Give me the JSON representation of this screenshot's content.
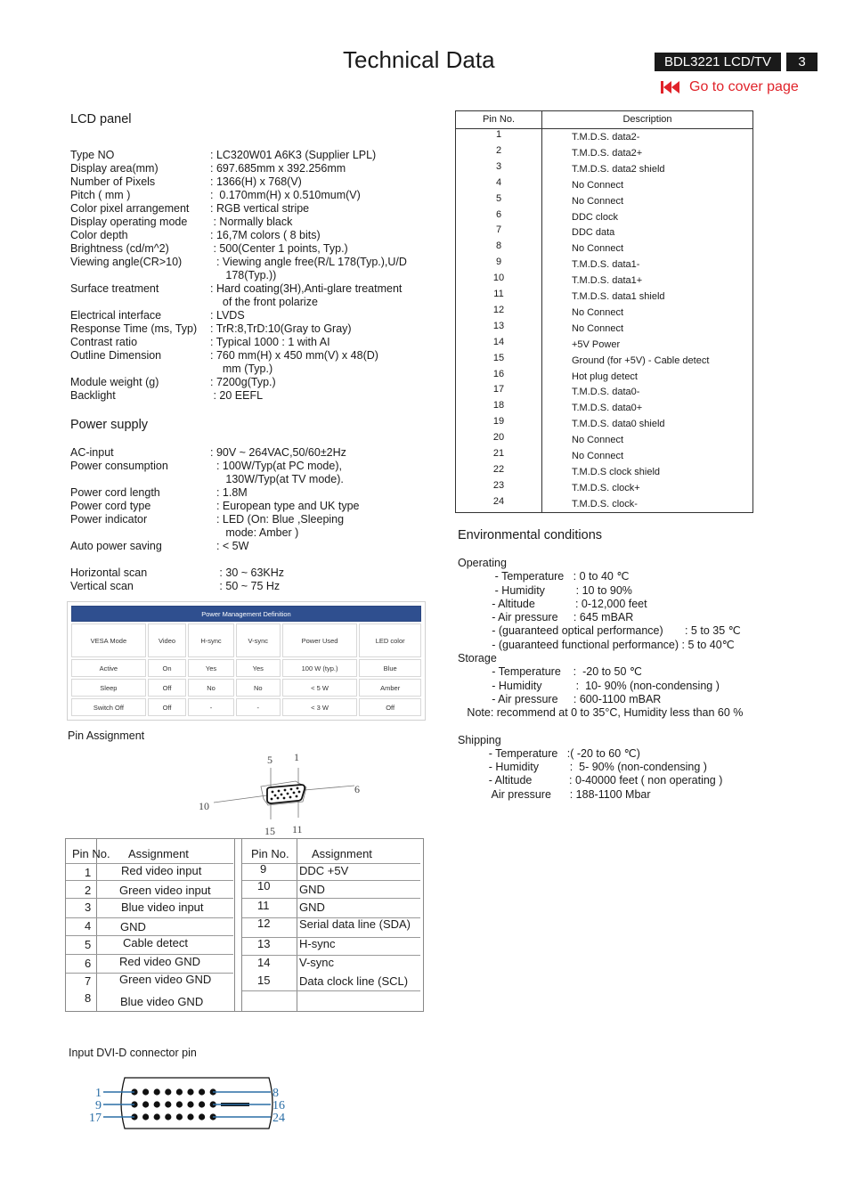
{
  "header": {
    "title": "Technical Data",
    "model": "BDL3221 LCD/TV",
    "page_number": "3",
    "cover_link": "Go to cover page",
    "accent_color": "#e0232a"
  },
  "lcd_panel": {
    "heading": "LCD panel",
    "specs": [
      {
        "label": "Type NO",
        "value": ": LC320W01 A6K3 (Supplier LPL)"
      },
      {
        "label": "Display area(mm)",
        "value": ": 697.685mm x 392.256mm"
      },
      {
        "label": "Number of Pixels",
        "value": ": 1366(H) x 768(V)"
      },
      {
        "label": "Pitch ( mm )",
        "value": ":  0.170mm(H) x 0.510mum(V)"
      },
      {
        "label": "Color pixel arrangement",
        "value": ": RGB vertical stripe"
      },
      {
        "label": "Display operating mode",
        "value": " : Normally black"
      },
      {
        "label": "Color depth",
        "value": ": 16,7M colors ( 8 bits)"
      },
      {
        "label": "Brightness (cd/m^2)",
        "value": " : 500(Center 1 points, Typ.)"
      },
      {
        "label": "Viewing angle(CR>10)",
        "value": "  : Viewing angle free(R/L 178(Typ.),U/D\n     178(Typ.))"
      },
      {
        "label": "Surface treatment",
        "value": ": Hard coating(3H),Anti-glare treatment\n    of the front polarize"
      },
      {
        "label": "Electrical interface",
        "value": ": LVDS"
      },
      {
        "label": "Response Time (ms, Typ)",
        "value": ": TrR:8,TrD:10(Gray to Gray)"
      },
      {
        "label": "Contrast ratio",
        "value": ": Typical 1000 : 1 with AI"
      },
      {
        "label": "Outline Dimension",
        "value": ": 760 mm(H) x 450 mm(V) x 48(D)\n    mm (Typ.)"
      },
      {
        "label": "Module weight (g)",
        "value": ": 7200g(Typ.)"
      },
      {
        "label": " Backlight",
        "value": " : 20 EEFL"
      }
    ]
  },
  "power_supply": {
    "heading": "Power supply",
    "specs": [
      {
        "label": "AC-input",
        "value": ": 90V ~ 264VAC,50/60±2Hz"
      },
      {
        "label": "Power consumption",
        "value": "  : 100W/Typ(at PC mode),\n     130W/Typ(at TV mode)."
      },
      {
        "label": "Power cord length",
        "value": "  : 1.8M"
      },
      {
        "label": "Power cord type",
        "value": "  : European type and UK type"
      },
      {
        "label": "Power indicator",
        "value": "  : LED (On: Blue ,Sleeping\n     mode: Amber )"
      },
      {
        "label": "Auto power saving",
        "value": "  : < 5W"
      }
    ],
    "scan": [
      {
        "label": "Horizontal scan",
        "value": "   : 30 ~ 63KHz"
      },
      {
        "label": "Vertical scan",
        "value": "   : 50 ~ 75 Hz"
      }
    ]
  },
  "power_management": {
    "title": "Power Management Definition",
    "header_color": "#2f4f8f",
    "columns": [
      "VESA Mode",
      "Video",
      "H-sync",
      "V-sync",
      "Power Used",
      "LED color"
    ],
    "rows": [
      [
        "Active",
        "On",
        "Yes",
        "Yes",
        "100 W (typ.)",
        "Blue"
      ],
      [
        "Sleep",
        "Off",
        "No",
        "No",
        "< 5 W",
        "Amber"
      ],
      [
        "Switch Off",
        "Off",
        "-",
        "-",
        "< 3 W",
        "Off"
      ]
    ]
  },
  "pin_assignment": {
    "heading": "Pin Assignment",
    "connector_labels": {
      "top_left": "5",
      "top_right": "1",
      "right": "6",
      "left": "10",
      "bottom_left": "15",
      "bottom_right": "11"
    },
    "col_pin": "Pin No.",
    "col_assignment": "Assignment",
    "left_pins": [
      {
        "pin": "1",
        "assignment": "Red video input"
      },
      {
        "pin": "2",
        "assignment": "Green video input"
      },
      {
        "pin": "3",
        "assignment": "Blue video input"
      },
      {
        "pin": "4",
        "assignment": "GND"
      },
      {
        "pin": "5",
        "assignment": "Cable detect"
      },
      {
        "pin": "6",
        "assignment": "Red video GND"
      },
      {
        "pin": "7",
        "assignment": "Green video GND"
      },
      {
        "pin": "8",
        "assignment": "Blue video GND"
      }
    ],
    "right_pins": [
      {
        "pin": "9",
        "assignment": "DDC  +5V"
      },
      {
        "pin": "10",
        "assignment": "GND"
      },
      {
        "pin": "11",
        "assignment": "GND"
      },
      {
        "pin": "12",
        "assignment": "Serial data line (SDA)"
      },
      {
        "pin": "13",
        "assignment": "H-sync"
      },
      {
        "pin": "14",
        "assignment": "V-sync"
      },
      {
        "pin": "15",
        "assignment": "Data clock line (SCL)"
      }
    ]
  },
  "dvi": {
    "heading": "Input DVI-D connector pin",
    "labels_left": [
      "1",
      "9",
      "17"
    ],
    "labels_right": [
      "8",
      "16",
      "24"
    ],
    "label_color": "#2a6ea6",
    "table": {
      "col_pin": "Pin No.",
      "col_desc": "Description",
      "rows": [
        {
          "pin": "1",
          "desc": "T.M.D.S. data2-"
        },
        {
          "pin": "2",
          "desc": "T.M.D.S. data2+"
        },
        {
          "pin": "3",
          "desc": "T.M.D.S. data2 shield"
        },
        {
          "pin": "4",
          "desc": "No Connect"
        },
        {
          "pin": "5",
          "desc": "No Connect"
        },
        {
          "pin": "6",
          "desc": "DDC clock"
        },
        {
          "pin": "7",
          "desc": "DDC data"
        },
        {
          "pin": "8",
          "desc": "No Connect"
        },
        {
          "pin": "9",
          "desc": "T.M.D.S. data1-"
        },
        {
          "pin": "10",
          "desc": "T.M.D.S. data1+"
        },
        {
          "pin": "11",
          "desc": "T.M.D.S. data1 shield"
        },
        {
          "pin": "12",
          "desc": "No Connect"
        },
        {
          "pin": "13",
          "desc": "No Connect"
        },
        {
          "pin": "14",
          "desc": "+5V Power"
        },
        {
          "pin": "15",
          "desc": "Ground (for +5V) - Cable detect"
        },
        {
          "pin": "16",
          "desc": "Hot plug detect"
        },
        {
          "pin": "17",
          "desc": "T.M.D.S. data0-"
        },
        {
          "pin": "18",
          "desc": "T.M.D.S. data0+"
        },
        {
          "pin": "19",
          "desc": "T.M.D.S. data0 shield"
        },
        {
          "pin": "20",
          "desc": "No Connect"
        },
        {
          "pin": "21",
          "desc": "No Connect"
        },
        {
          "pin": "22",
          "desc": "T.M.D.S clock shield"
        },
        {
          "pin": "23",
          "desc": "T.M.D.S. clock+"
        },
        {
          "pin": "24",
          "desc": "T.M.D.S. clock-"
        }
      ]
    }
  },
  "environment": {
    "heading": "Environmental conditions",
    "operating": {
      "label": "Operating",
      "lines": [
        "            - Temperature   : 0 to 40 ℃",
        "            - Humidity          : 10 to 90%",
        "           - Altitude             : 0-12,000 feet",
        "           - Air pressure     : 645 mBAR",
        "           - (guaranteed optical performance)       : 5 to 35 ℃",
        "           - (guaranteed functional performance) : 5 to 40℃"
      ]
    },
    "storage": {
      "label": "Storage",
      "lines": [
        "           - Temperature    :  -20 to 50 ℃",
        "           - Humidity           :  10- 90% (non-condensing )",
        "           - Air pressure     : 600-1100 mBAR"
      ],
      "note": "   Note: recommend at 0 to 35°C, Humidity less than 60 %"
    },
    "shipping": {
      "label": "Shipping",
      "lines": [
        "          - Temperature   :( -20 to 60 ℃)",
        "          - Humidity          :  5- 90% (non-condensing )",
        "          - Altitude            : 0-40000 feet ( non operating )",
        "           Air pressure      : 188-1100 Mbar"
      ]
    }
  }
}
